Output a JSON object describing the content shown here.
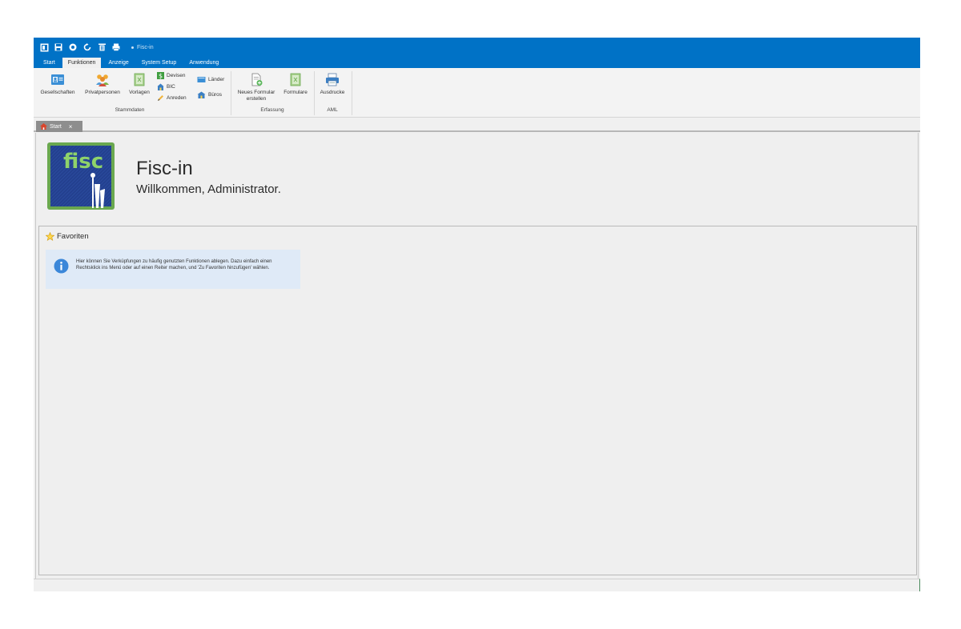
{
  "window": {
    "title": "Fisc-in",
    "quick_access_icons": [
      "app-icon",
      "save-icon",
      "globe-icon",
      "refresh-icon",
      "delete-icon",
      "print-icon"
    ]
  },
  "ribbon_tabs": [
    {
      "label": "Start",
      "active": false
    },
    {
      "label": "Funktionen",
      "active": true
    },
    {
      "label": "Anzeige",
      "active": false
    },
    {
      "label": "System Setup",
      "active": false
    },
    {
      "label": "Anwendung",
      "active": false
    }
  ],
  "ribbon": {
    "stammdaten": {
      "label": "Stammdaten",
      "gesellschaften": "Gesellschaften",
      "privatpersonen": "Privatpersonen",
      "vorlagen": "Vorlagen",
      "devisen": "Devisen",
      "bic": "BIC",
      "anreden": "Anreden",
      "laender": "Länder",
      "bueros": "Büros"
    },
    "erfassung": {
      "label": "Erfassung",
      "neues_formular_line1": "Neues Formular",
      "neues_formular_line2": "erstellen",
      "formulare": "Formulare"
    },
    "aml": {
      "label": "AML",
      "ausdrucke": "Ausdrucke"
    }
  },
  "doc_tab": {
    "label": "Start",
    "close": "×"
  },
  "home": {
    "logo_text": "fisc",
    "app_title": "Fisc-in",
    "welcome": "Willkommen, Administrator."
  },
  "favorites": {
    "title": "Favoriten",
    "info": "Hier können Sie Verküpfungen zu häufig genutzten Funktionen ablegen.  Dazu einfach einen Rechtsklick ins Menü oder auf einen Reiter machen, und 'Zu Favoriten hinzufügen' wählen."
  },
  "colors": {
    "titlebar": "#0072c6",
    "logo_green": "#6aa84f",
    "logo_blue": "#1f3f8f",
    "info_bg": "#dfeaf7"
  }
}
